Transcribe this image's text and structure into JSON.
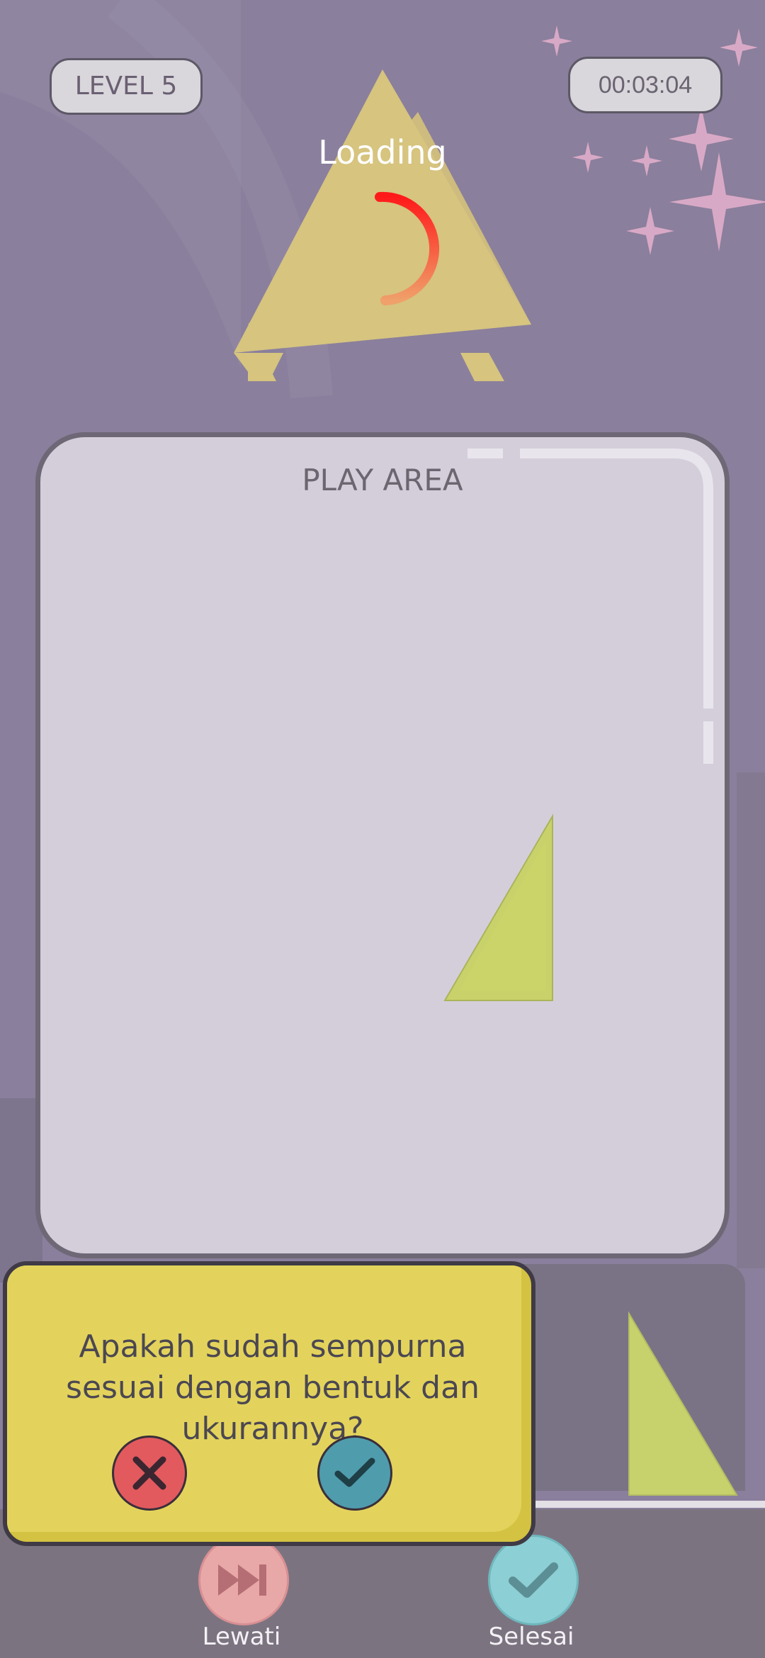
{
  "hud": {
    "level_label": "LEVEL 5",
    "timer": "00:03:04"
  },
  "loading": {
    "text": "Loading"
  },
  "play_area": {
    "label": "PLAY AREA"
  },
  "dialog": {
    "question": "Apakah sudah sempurna sesuai dengan bentuk dan ukurannya?",
    "no_icon": "close-icon",
    "yes_icon": "check-icon"
  },
  "bottom_bar": {
    "skip_label": "Lewati",
    "finish_label": "Selesai",
    "skip_icon": "fast-forward-icon",
    "finish_icon": "check-icon"
  },
  "colors": {
    "background": "#8a7f9c",
    "play_area": "#d4cedb",
    "shape_fill": "#c9d26a",
    "dialog": "#e3d35c",
    "no_button": "#e25a5e",
    "yes_button": "#4f9cad"
  }
}
